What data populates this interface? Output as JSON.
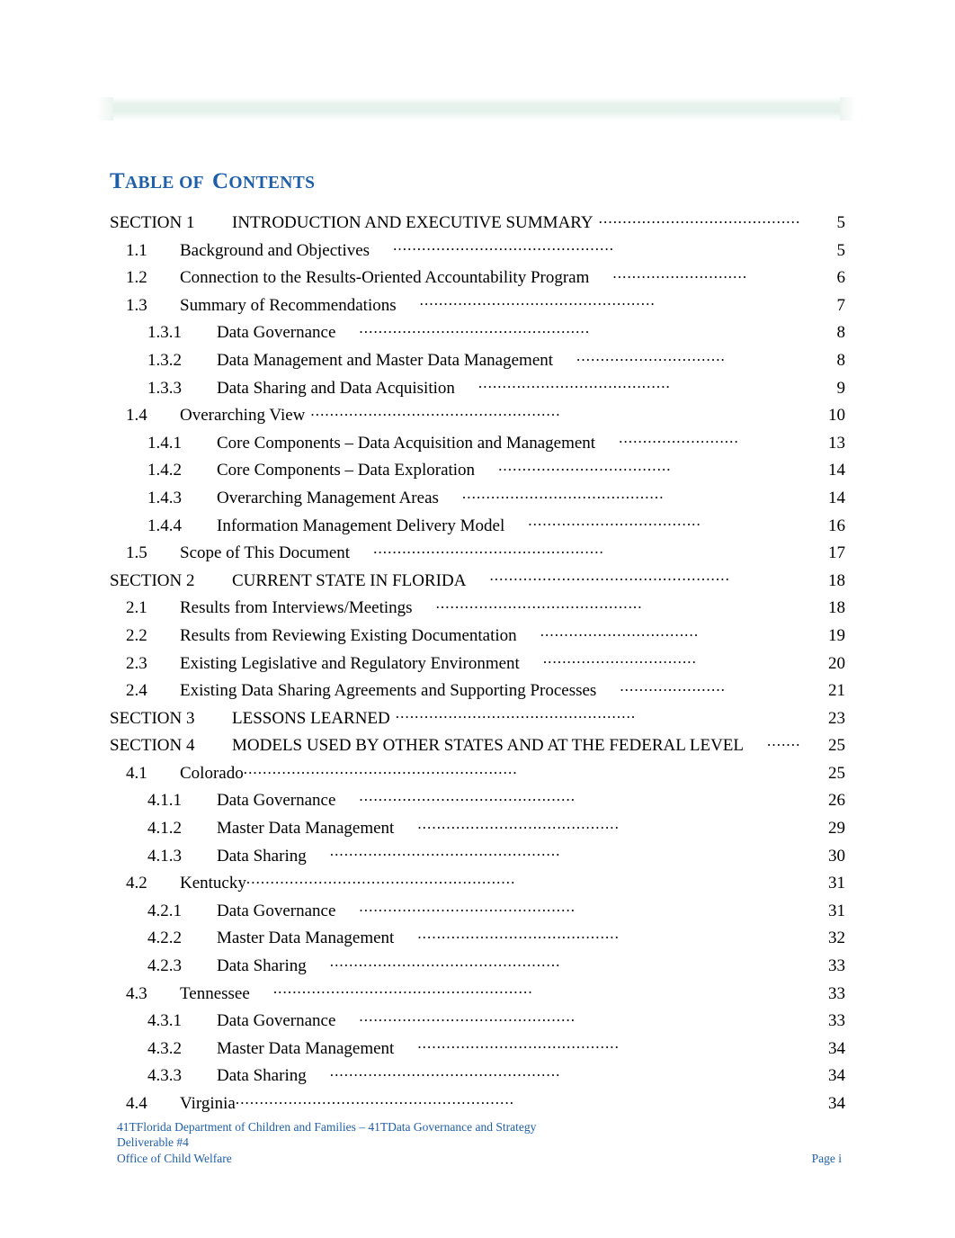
{
  "document": {
    "title_parts": [
      {
        "text": "T",
        "style": "cap"
      },
      {
        "text": "ABLE",
        "style": "sc"
      },
      {
        "text": " ",
        "style": "sc"
      },
      {
        "text": "OF",
        "style": "sc"
      },
      {
        "text": "C",
        "style": "cap"
      },
      {
        "text": "ONTENTS",
        "style": "sc"
      }
    ],
    "title_plain": "TABLE OF CONTENTS",
    "accent_color": "#1F5FA9",
    "band_color": "#E8F1EC"
  },
  "toc": {
    "entries": [
      {
        "level": 1,
        "number": "SECTION 1",
        "title": "INTRODUCTION AND EXECUTIVE SUMMARY",
        "page": "5",
        "dots": 45,
        "gap": "",
        "lead": ""
      },
      {
        "level": 2,
        "number": "1.1",
        "title": "Background and Objectives",
        "page": "5",
        "dots": 46,
        "gap": "",
        "lead": "leader-loose"
      },
      {
        "level": 2,
        "number": "1.2",
        "title": "Connection to the Results-Oriented Accountability Program",
        "page": "6",
        "dots": 28,
        "gap": "",
        "lead": "leader-loose"
      },
      {
        "level": 2,
        "number": "1.3",
        "title": "Summary of Recommendations",
        "page": "7",
        "dots": 49,
        "gap": "",
        "lead": "leader-loose"
      },
      {
        "level": 3,
        "number": "1.3.1",
        "title": "Data Governance",
        "page": "8",
        "dots": 48,
        "gap": "",
        "lead": "leader-loose"
      },
      {
        "level": 3,
        "number": "1.3.2",
        "title": "Data Management and Master Data Management",
        "page": "8",
        "dots": 31,
        "gap": "",
        "lead": "leader-loose"
      },
      {
        "level": 3,
        "number": "1.3.3",
        "title": "Data Sharing and Data Acquisition",
        "page": "9",
        "dots": 40,
        "gap": "gap-sm",
        "lead": "leader-loose"
      },
      {
        "level": 2,
        "number": "1.4",
        "title": "Overarching View",
        "page": "10",
        "dots": 52,
        "gap": "gap-sm",
        "lead": ""
      },
      {
        "level": 3,
        "number": "1.4.1",
        "title": "Core Components – Data Acquisition and Management",
        "page": "13",
        "dots": 25,
        "gap": "",
        "lead": "leader-loose"
      },
      {
        "level": 3,
        "number": "1.4.2",
        "title": "Core Components – Data Exploration",
        "page": "14",
        "dots": 36,
        "gap": "",
        "lead": "leader-loose"
      },
      {
        "level": 3,
        "number": "1.4.3",
        "title": "Overarching Management Areas",
        "page": "14",
        "dots": 42,
        "gap": "",
        "lead": "leader-loose"
      },
      {
        "level": 3,
        "number": "1.4.4",
        "title": "Information Management Delivery Model",
        "page": "16",
        "dots": 36,
        "gap": "gap-sm",
        "lead": "leader-loose"
      },
      {
        "level": 2,
        "number": "1.5",
        "title": "Scope of This Document",
        "page": "17",
        "dots": 48,
        "gap": "gap-sm",
        "lead": "leader-loose"
      },
      {
        "level": 1,
        "number": "SECTION 2",
        "title": "CURRENT STATE IN FLORIDA",
        "page": "18",
        "dots": 50,
        "gap": "",
        "lead": "leader-loose"
      },
      {
        "level": 2,
        "number": "2.1",
        "title": "Results from Interviews/Meetings",
        "page": "18",
        "dots": 43,
        "gap": "",
        "lead": "leader-loose"
      },
      {
        "level": 2,
        "number": "2.2",
        "title": "Results from Reviewing Existing Documentation",
        "page": "19",
        "dots": 33,
        "gap": "",
        "lead": "leader-loose"
      },
      {
        "level": 2,
        "number": "2.3",
        "title": "Existing Legislative and Regulatory Environment",
        "page": "20",
        "dots": 32,
        "gap": "",
        "lead": "leader-loose"
      },
      {
        "level": 2,
        "number": "2.4",
        "title": "Existing Data Sharing Agreements and Supporting Processes",
        "page": "21",
        "dots": 22,
        "gap": "",
        "lead": "leader-loose"
      },
      {
        "level": 1,
        "number": "SECTION 3",
        "title": "LESSONS LEARNED",
        "page": "23",
        "dots": 50,
        "gap": "gap-sm",
        "lead": ""
      },
      {
        "level": 1,
        "number": "SECTION 4",
        "title": "MODELS USED BY OTHER STATES AND AT THE FEDERAL LEVEL",
        "page": "25",
        "dots": 7,
        "gap": "",
        "lead": "leader-loose"
      },
      {
        "level": 2,
        "number": "4.1",
        "title": "Colorado",
        "page": "25",
        "dots": 57,
        "gap": "gap-sm",
        "lead": "leader-tight"
      },
      {
        "level": 3,
        "number": "4.1.1",
        "title": "Data Governance",
        "page": "26",
        "dots": 45,
        "gap": "gap-sm",
        "lead": "leader-loose"
      },
      {
        "level": 3,
        "number": "4.1.2",
        "title": "Master Data Management",
        "page": "29",
        "dots": 42,
        "gap": "gap-sm",
        "lead": "leader-loose"
      },
      {
        "level": 3,
        "number": "4.1.3",
        "title": "Data Sharing",
        "page": "30",
        "dots": 48,
        "gap": "gap-sm",
        "lead": "leader-loose"
      },
      {
        "level": 2,
        "number": "4.2",
        "title": "Kentucky",
        "page": "31",
        "dots": 56,
        "gap": "gap-sm",
        "lead": "leader-tight"
      },
      {
        "level": 3,
        "number": "4.2.1",
        "title": "Data Governance",
        "page": "31",
        "dots": 45,
        "gap": "gap-sm",
        "lead": "leader-loose"
      },
      {
        "level": 3,
        "number": "4.2.2",
        "title": "Master Data Management",
        "page": "32",
        "dots": 42,
        "gap": "gap-sm",
        "lead": "leader-loose"
      },
      {
        "level": 3,
        "number": "4.2.3",
        "title": "Data Sharing",
        "page": "33",
        "dots": 48,
        "gap": "gap-sm",
        "lead": "leader-loose"
      },
      {
        "level": 2,
        "number": "4.3",
        "title": "Tennessee",
        "page": "33",
        "dots": 54,
        "gap": "gap-sm",
        "lead": "leader-loose"
      },
      {
        "level": 3,
        "number": "4.3.1",
        "title": "Data Governance",
        "page": "33",
        "dots": 45,
        "gap": "gap-sm",
        "lead": "leader-loose"
      },
      {
        "level": 3,
        "number": "4.3.2",
        "title": "Master Data Management",
        "page": "34",
        "dots": 42,
        "gap": "gap-sm",
        "lead": "leader-loose"
      },
      {
        "level": 3,
        "number": "4.3.3",
        "title": "Data Sharing",
        "page": "34",
        "dots": 48,
        "gap": "gap-sm",
        "lead": "leader-loose"
      },
      {
        "level": 2,
        "number": "4.4",
        "title": "Virginia",
        "page": "34",
        "dots": 58,
        "gap": "gap-sm",
        "lead": "leader-tight"
      }
    ]
  },
  "footer": {
    "line1": "41TFlorida Department of Children and Families – 41TData Governance and Strategy",
    "line2": "Deliverable #4",
    "office": "Office of Child Welfare",
    "page_label": "Page i"
  }
}
